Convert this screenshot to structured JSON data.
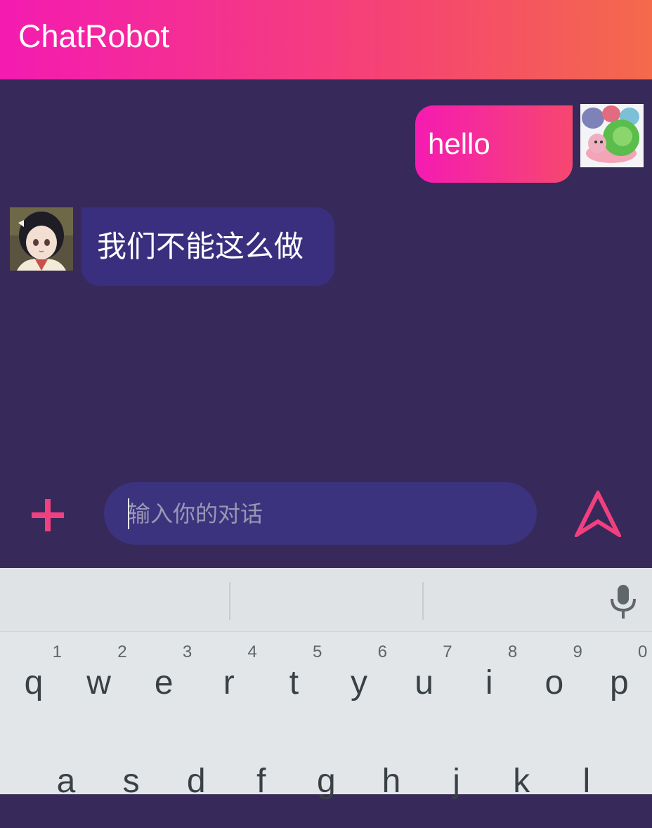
{
  "app": {
    "title": "ChatRobot",
    "colors": {
      "header_start": "#f41bb1",
      "header_end": "#f46a4b",
      "background": "#37295a",
      "accent": "#f0407f"
    }
  },
  "messages": [
    {
      "direction": "sent",
      "text": "hello",
      "avatar": "snail-toy-avatar"
    },
    {
      "direction": "received",
      "text": "我们不能这么做",
      "avatar": "anime-girl-avatar"
    }
  ],
  "composer": {
    "attach_icon": "plus-icon",
    "placeholder": "输入你的对话",
    "value": "",
    "send_icon": "send-arrow-icon"
  },
  "keyboard": {
    "mic_icon": "microphone-icon",
    "row1": [
      {
        "letter": "q",
        "hint": "1"
      },
      {
        "letter": "w",
        "hint": "2"
      },
      {
        "letter": "e",
        "hint": "3"
      },
      {
        "letter": "r",
        "hint": "4"
      },
      {
        "letter": "t",
        "hint": "5"
      },
      {
        "letter": "y",
        "hint": "6"
      },
      {
        "letter": "u",
        "hint": "7"
      },
      {
        "letter": "i",
        "hint": "8"
      },
      {
        "letter": "o",
        "hint": "9"
      },
      {
        "letter": "p",
        "hint": "0"
      }
    ],
    "row2": [
      {
        "letter": "a"
      },
      {
        "letter": "s"
      },
      {
        "letter": "d"
      },
      {
        "letter": "f"
      },
      {
        "letter": "g"
      },
      {
        "letter": "h"
      },
      {
        "letter": "j"
      },
      {
        "letter": "k"
      },
      {
        "letter": "l"
      }
    ]
  }
}
